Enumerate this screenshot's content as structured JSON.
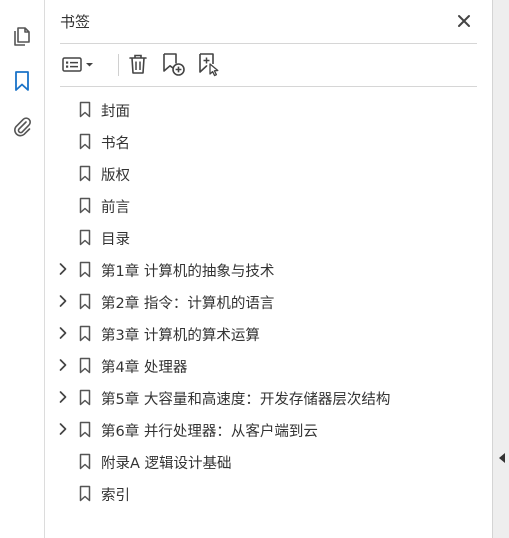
{
  "panel": {
    "title": "书签"
  },
  "left_rail": {
    "items": [
      {
        "icon": "pages-icon"
      },
      {
        "icon": "bookmark-icon",
        "active": true
      },
      {
        "icon": "attachment-icon"
      }
    ]
  },
  "toolbar": {
    "buttons": [
      "options-menu-icon",
      "delete-icon",
      "new-bookmark-icon",
      "new-bookmark-from-selection-icon"
    ]
  },
  "colors": {
    "accent": "#1a73c8",
    "icon_gray": "#555555",
    "divider": "#d6d6d6"
  },
  "bookmarks": [
    {
      "label": "封面",
      "expandable": false
    },
    {
      "label": "书名",
      "expandable": false
    },
    {
      "label": "版权",
      "expandable": false
    },
    {
      "label": "前言",
      "expandable": false
    },
    {
      "label": "目录",
      "expandable": false
    },
    {
      "label": "第1章  计算机的抽象与技术",
      "expandable": true
    },
    {
      "label": "第2章  指令：计算机的语言",
      "expandable": true
    },
    {
      "label": "第3章  计算机的算术运算",
      "expandable": true
    },
    {
      "label": "第4章  处理器",
      "expandable": true
    },
    {
      "label": "第5章  大容量和高速度：开发存储器层次结构",
      "expandable": true
    },
    {
      "label": "第6章  并行处理器：从客户端到云",
      "expandable": true
    },
    {
      "label": "附录A  逻辑设计基础",
      "expandable": false
    },
    {
      "label": "索引",
      "expandable": false
    }
  ]
}
